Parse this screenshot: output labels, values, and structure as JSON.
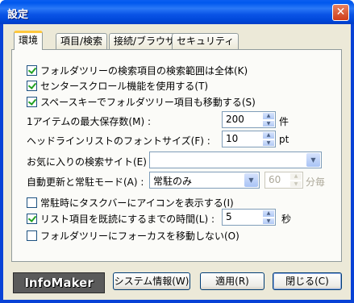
{
  "window": {
    "title": "設定",
    "close_glyph": "✕"
  },
  "tabs": [
    {
      "label": "環境",
      "active": true
    },
    {
      "label": "項目/検索",
      "active": false
    },
    {
      "label": "接続/ブラウザ",
      "active": false
    },
    {
      "label": "セキュリティ",
      "active": false
    }
  ],
  "options": {
    "folder_tree_search": {
      "label": "フォルダツリーの検索項目の検索範囲は全体(K)",
      "checked": true
    },
    "center_scroll": {
      "label": "センタースクロール機能を使用する(T)",
      "checked": true
    },
    "space_key_move": {
      "label": "スペースキーでフォルダツリー項目も移動する(S)",
      "checked": true
    },
    "max_items": {
      "label": "1アイテムの最大保存数(M) :",
      "value": "200",
      "unit": "件"
    },
    "headline_font_size": {
      "label": "ヘッドラインリストのフォントサイズ(F) :",
      "value": "10",
      "unit": "pt"
    },
    "favorite_search_site": {
      "label": "お気に入りの検索サイト(E) :",
      "value": ""
    },
    "auto_update_mode": {
      "label": "自動更新と常駐モード(A) :",
      "value": "常駐のみ",
      "interval_value": "60",
      "interval_unit": "分毎"
    },
    "taskbar_icon": {
      "label": "常駐時にタスクバーにアイコンを表示する(I)",
      "checked": false
    },
    "mark_read_time": {
      "label": "リスト項目を既読にするまでの時間(L) :",
      "checked": true,
      "value": "5",
      "unit": "秒"
    },
    "no_focus_folder_tree": {
      "label": "フォルダツリーにフォーカスを移動しない(O)",
      "checked": false
    }
  },
  "footer": {
    "logo": "InfoMaker",
    "system_info_button": "システム情報(W)",
    "apply_button": "適用(R)",
    "close_button": "閉じる(C)"
  },
  "icons": {
    "spin_up": "▲",
    "spin_down": "▼",
    "dropdown": "▼"
  }
}
